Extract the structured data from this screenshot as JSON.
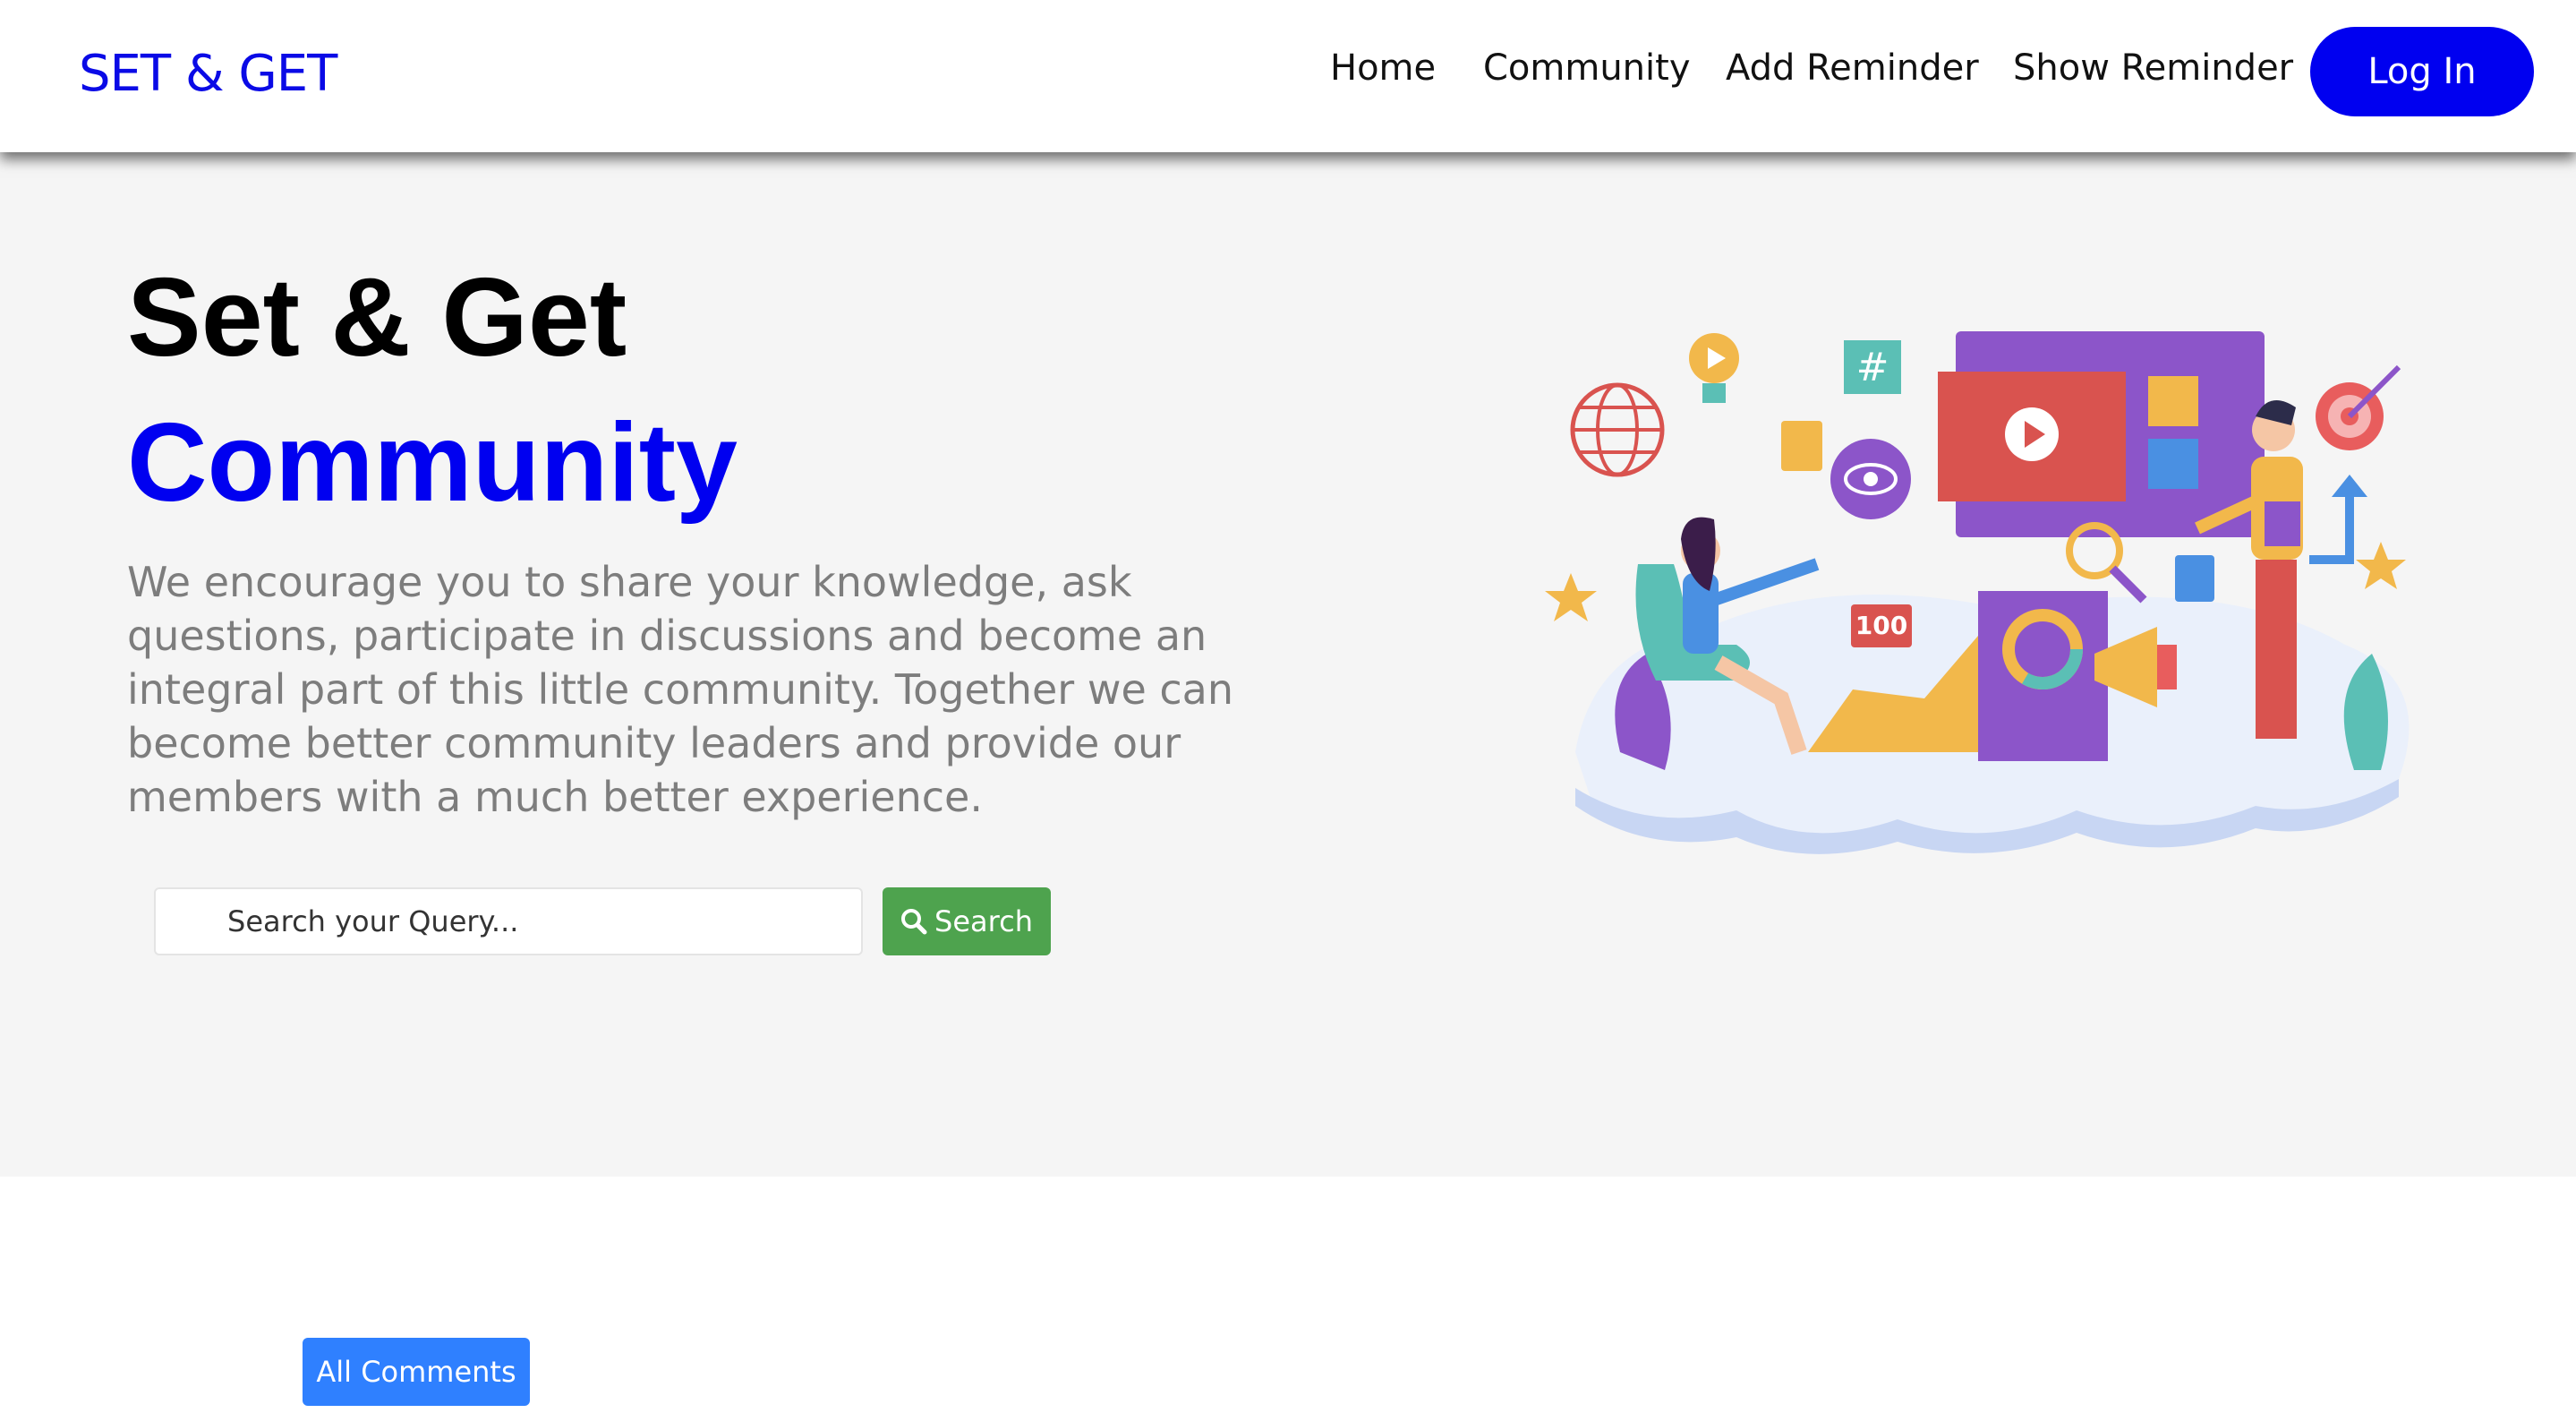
{
  "header": {
    "brand": "SET & GET",
    "nav": [
      {
        "label": "Home"
      },
      {
        "label": "Community"
      },
      {
        "label": "Add Reminder"
      },
      {
        "label": "Show Reminder"
      }
    ],
    "login_label": "Log In"
  },
  "hero": {
    "title_line1": "Set & Get",
    "title_line2": "Community",
    "description": "We encourage you to share your knowledge, ask questions, participate in discussions and become an integral part of this little community. Together we can become better community leaders and provide our members with a much better experience.",
    "search": {
      "placeholder": "Search your Query...",
      "button_label": "Search",
      "button_icon": "search-icon"
    },
    "illustration_badge": "100"
  },
  "comments": {
    "button_label": "All Comments"
  },
  "colors": {
    "brand": "#0a0ae6",
    "primary_blue": "#0000f0",
    "search_green": "#4ea34e",
    "comments_blue": "#2f80ff",
    "hero_bg": "#f5f5f5"
  }
}
